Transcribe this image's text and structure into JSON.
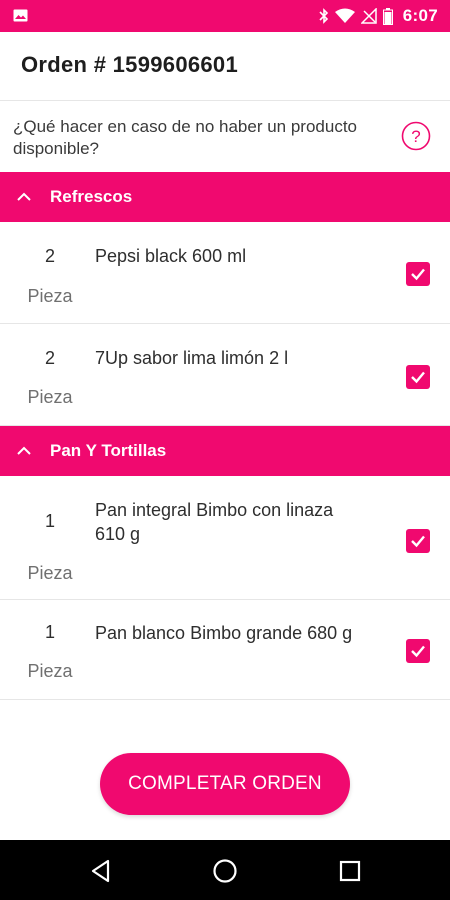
{
  "status_bar": {
    "time": "6:07",
    "color": "#f0096f",
    "icons": [
      "image-icon",
      "bluetooth-icon",
      "wifi-icon",
      "signal-icon",
      "battery-icon"
    ]
  },
  "header": {
    "title": "Orden # 1599606601"
  },
  "question": {
    "text": "¿Qué hacer en caso de no haber un producto disponible?",
    "icon": "help-circle-icon"
  },
  "categories": [
    {
      "label": "Refrescos",
      "items": [
        {
          "qty": "2",
          "unit": "Pieza",
          "name": "Pepsi black 600 ml",
          "checked": true
        },
        {
          "qty": "2",
          "unit": "Pieza",
          "name": "7Up sabor lima limón 2 l",
          "checked": true
        }
      ]
    },
    {
      "label": "Pan Y Tortillas",
      "items": [
        {
          "qty": "1",
          "unit": "Pieza",
          "name": "Pan integral Bimbo con linaza 610 g",
          "checked": true
        },
        {
          "qty": "1",
          "unit": "Pieza",
          "name": "Pan blanco Bimbo grande 680 g",
          "checked": true
        }
      ]
    }
  ],
  "complete_button": {
    "label": "COMPLETAR ORDEN"
  },
  "nav_bar": {
    "icons": [
      "back-icon",
      "home-icon",
      "recents-icon"
    ]
  },
  "colors": {
    "accent": "#f0096f",
    "text_dark": "#1e1e1e",
    "text_muted": "#707070"
  }
}
